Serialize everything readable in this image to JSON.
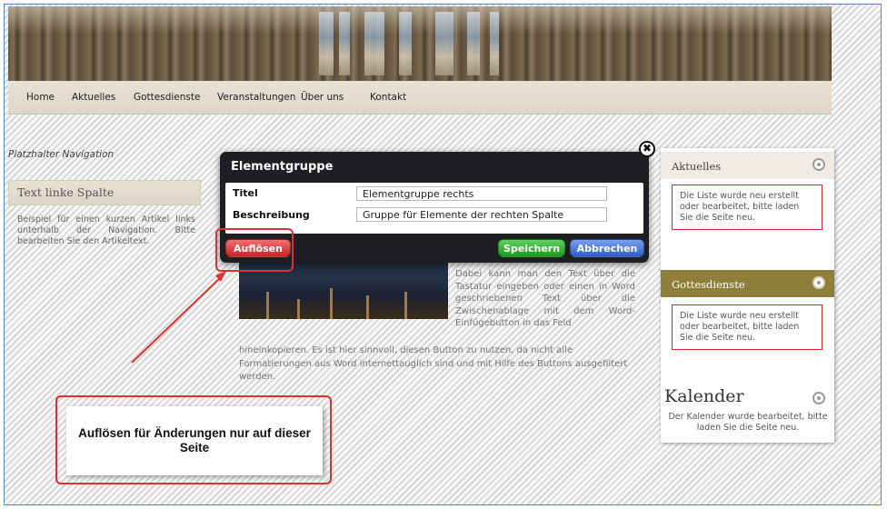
{
  "nav": {
    "items": [
      "Home",
      "Aktuelles",
      "Gottesdienste",
      "Veranstaltungen",
      "Über uns",
      "Kontakt"
    ]
  },
  "placeholder_nav": "Platzhalter Navigation",
  "left_column": {
    "title": "Text linke Spalte",
    "body": "Beispiel für einen kurzen Artikel links unterhalb der Navigation. Bitte bearbeiten Sie den Artikeltext."
  },
  "main": {
    "text_right": "Dabei kann man den Text über die Tastatur eingeben oder einen in Word geschriebenen Text über die Zwischenablage mit dem Word-Einfügebutton in das Feld",
    "text_bottom": "hineinkopieren. Es ist hier sinnvoll, diesen Button zu nutzen, da nicht alle Formatierungen aus Word internettauglich sind und mit Hilfe des Buttons ausgefiltert werden."
  },
  "dialog": {
    "title": "Elementgruppe",
    "close_glyph": "✖",
    "fields": [
      {
        "label": "Titel",
        "value": "Elementgruppe rechts"
      },
      {
        "label": "Beschreibung",
        "value": "Gruppe für Elemente der rechten Spalte"
      }
    ],
    "buttons": {
      "dissolve": "Auflösen",
      "save": "Speichern",
      "cancel": "Abbrechen"
    }
  },
  "right_column": {
    "aktuelles": {
      "title": "Aktuelles",
      "message": "Die Liste wurde neu erstellt oder bearbeitet, bitte laden Sie die Seite neu."
    },
    "gottesdienste": {
      "title": "Gottesdienste",
      "message": "Die Liste wurde neu erstellt oder bearbeitet, bitte laden Sie die Seite neu."
    },
    "kalender": {
      "title": "Kalender",
      "message": "Der Kalender wurde bearbeitet, bitte laden Sie die Seite neu."
    }
  },
  "annotation": {
    "callout": "Auflösen für Änderungen nur auf dieser Seite"
  },
  "colors": {
    "accent_olive": "#8f7f3a",
    "annotation_red": "#e03030",
    "dialog_bg": "#1d1f22"
  }
}
